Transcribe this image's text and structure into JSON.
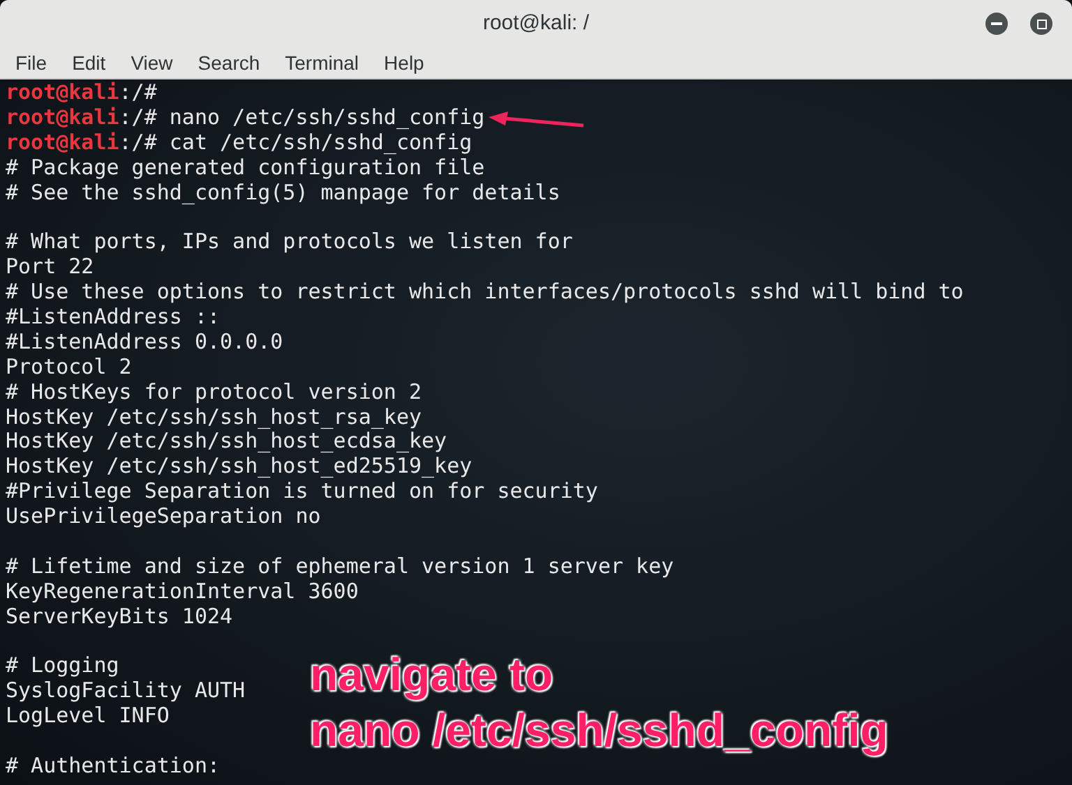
{
  "window": {
    "title": "root@kali: /"
  },
  "menu": [
    "File",
    "Edit",
    "View",
    "Search",
    "Terminal",
    "Help"
  ],
  "terminal_lines": [
    {
      "kind": "prompt",
      "user": "root@kali",
      "path": ":/#"
    },
    {
      "kind": "prompt",
      "user": "root@kali",
      "path": ":/#",
      "command": "nano /etc/ssh/sshd_config"
    },
    {
      "kind": "prompt",
      "user": "root@kali",
      "path": ":/#",
      "command": "cat /etc/ssh/sshd_config"
    },
    {
      "kind": "text",
      "text": "# Package generated configuration file"
    },
    {
      "kind": "text",
      "text": "# See the sshd_config(5) manpage for details"
    },
    {
      "kind": "blank"
    },
    {
      "kind": "text",
      "text": "# What ports, IPs and protocols we listen for"
    },
    {
      "kind": "text",
      "text": "Port 22"
    },
    {
      "kind": "text",
      "text": "# Use these options to restrict which interfaces/protocols sshd will bind to"
    },
    {
      "kind": "text",
      "text": "#ListenAddress ::"
    },
    {
      "kind": "text",
      "text": "#ListenAddress 0.0.0.0"
    },
    {
      "kind": "text",
      "text": "Protocol 2"
    },
    {
      "kind": "text",
      "text": "# HostKeys for protocol version 2"
    },
    {
      "kind": "text",
      "text": "HostKey /etc/ssh/ssh_host_rsa_key"
    },
    {
      "kind": "text",
      "text": "HostKey /etc/ssh/ssh_host_ecdsa_key"
    },
    {
      "kind": "text",
      "text": "HostKey /etc/ssh/ssh_host_ed25519_key"
    },
    {
      "kind": "text",
      "text": "#Privilege Separation is turned on for security"
    },
    {
      "kind": "text",
      "text": "UsePrivilegeSeparation no"
    },
    {
      "kind": "blank"
    },
    {
      "kind": "text",
      "text": "# Lifetime and size of ephemeral version 1 server key"
    },
    {
      "kind": "text",
      "text": "KeyRegenerationInterval 3600"
    },
    {
      "kind": "text",
      "text": "ServerKeyBits 1024"
    },
    {
      "kind": "blank"
    },
    {
      "kind": "text",
      "text": "# Logging"
    },
    {
      "kind": "text",
      "text": "SyslogFacility AUTH"
    },
    {
      "kind": "text",
      "text": "LogLevel INFO"
    },
    {
      "kind": "blank"
    },
    {
      "kind": "text",
      "text": "# Authentication:"
    }
  ],
  "annotation": {
    "lines": [
      "navigate to",
      "nano /etc/ssh/sshd_config"
    ]
  }
}
